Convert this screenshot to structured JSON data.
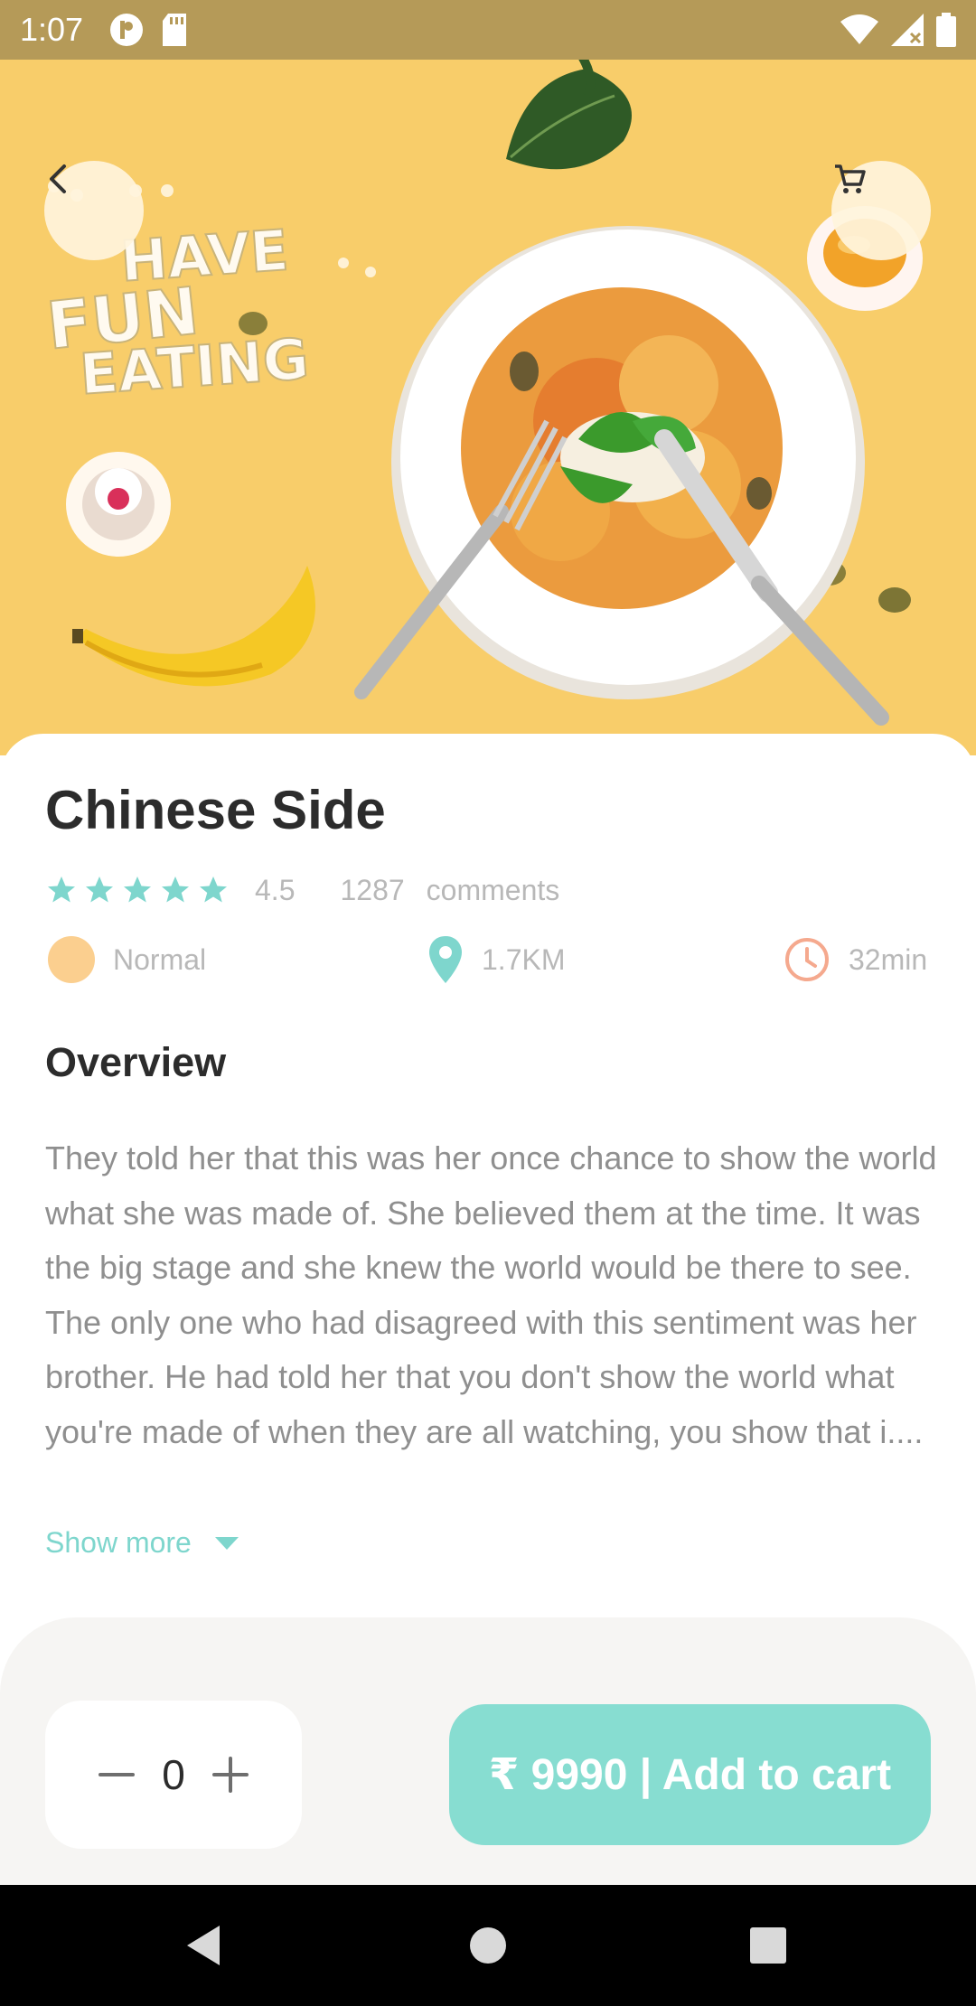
{
  "status_bar": {
    "time": "1:07",
    "icons": [
      "p-icon",
      "sd-card-icon",
      "wifi-icon",
      "signal-icon",
      "battery-icon"
    ]
  },
  "hero": {
    "image_lettering": "HAVE FUN EATING",
    "background_color": "#f8cd6a"
  },
  "product": {
    "title": "Chinese Side",
    "rating": "4.5",
    "stars": 5,
    "comments_count": "1287",
    "comments_label": "comments",
    "spice_level": "Normal",
    "distance": "1.7KM",
    "time": "32min"
  },
  "overview": {
    "heading": "Overview",
    "text": "They told her that this was her once chance to show the world what she was made of. She believed them at the time. It was the big stage and she knew the world would be there to see. The only one who had disagreed with this sentiment was her brother. He had told her that you don't show the world what you're made of when they are all watching, you show that i....",
    "show_more": "Show more"
  },
  "cart": {
    "quantity": "0",
    "add_label": "₹ 9990 | Add to cart"
  },
  "colors": {
    "accent": "#7ed6cd",
    "button": "#87ddd1",
    "title": "#2c2c2c",
    "muted": "#b8b8b8",
    "body_text": "#8f8f8f"
  }
}
